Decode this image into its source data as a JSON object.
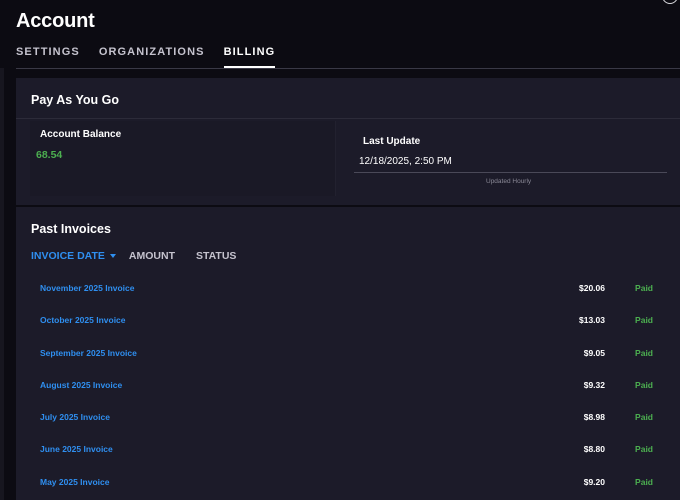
{
  "header": {
    "title": "Account"
  },
  "tabs": [
    {
      "label": "SETTINGS",
      "active": false
    },
    {
      "label": "ORGANIZATIONS",
      "active": false
    },
    {
      "label": "BILLING",
      "active": true
    }
  ],
  "pay_as_you_go": {
    "title": "Pay As You Go",
    "balance_label": "Account Balance",
    "balance_value": "68.54",
    "last_update_label": "Last Update",
    "last_update_value": "12/18/2025, 2:50 PM",
    "update_hint": "Updated Hourly"
  },
  "invoices": {
    "title": "Past Invoices",
    "columns": {
      "date": "INVOICE DATE",
      "amount": "AMOUNT",
      "status": "STATUS"
    },
    "rows": [
      {
        "name": "November 2025 Invoice",
        "amount": "$20.06",
        "status": "Paid"
      },
      {
        "name": "October 2025 Invoice",
        "amount": "$13.03",
        "status": "Paid"
      },
      {
        "name": "September 2025 Invoice",
        "amount": "$9.05",
        "status": "Paid"
      },
      {
        "name": "August 2025 Invoice",
        "amount": "$9.32",
        "status": "Paid"
      },
      {
        "name": "July 2025 Invoice",
        "amount": "$8.98",
        "status": "Paid"
      },
      {
        "name": "June 2025 Invoice",
        "amount": "$8.80",
        "status": "Paid"
      },
      {
        "name": "May 2025 Invoice",
        "amount": "$9.20",
        "status": "Paid"
      }
    ]
  },
  "colors": {
    "accent": "#2f8ff0",
    "positive": "#4caf50",
    "panel": "#1c1b29",
    "background": "#0c0b12"
  }
}
